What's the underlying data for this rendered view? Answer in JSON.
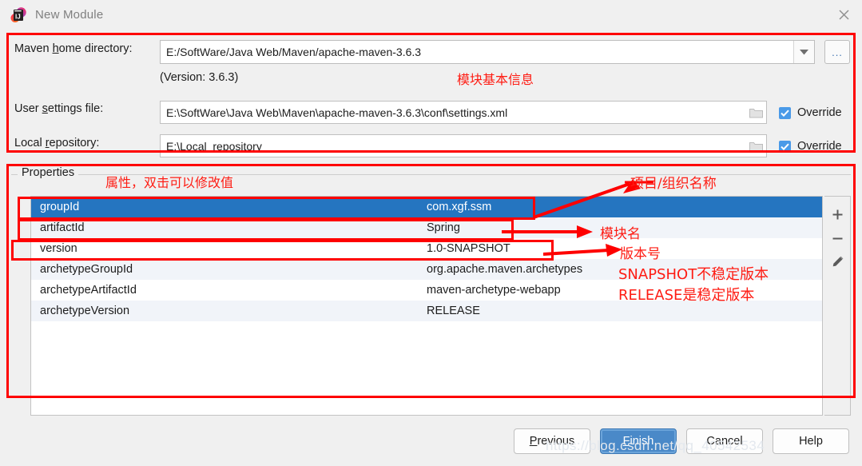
{
  "window": {
    "title": "New Module",
    "app_icon": "intellij-idea-icon",
    "close_icon": "close-icon"
  },
  "settings": {
    "maven_home": {
      "label_pre": "Maven ",
      "label_mnemonic": "h",
      "label_post": "ome directory:",
      "value": "E:/SoftWare/Java Web/Maven/apache-maven-3.6.3",
      "dropdown_icon": "chevron-down-icon",
      "browse_label": "...",
      "browse_icon": "ellipsis-icon"
    },
    "version_note": "(Version: 3.6.3)",
    "user_settings": {
      "label_pre": "User ",
      "label_mnemonic": "s",
      "label_post": "ettings file:",
      "value": "E:\\SoftWare\\Java Web\\Maven\\apache-maven-3.6.3\\conf\\settings.xml",
      "folder_icon": "folder-icon",
      "override_label": "Override",
      "override_checked": true
    },
    "local_repository": {
      "label_pre": "Local ",
      "label_mnemonic": "r",
      "label_post": "epository:",
      "value": "E:\\Local_repository",
      "folder_icon": "folder-icon",
      "override_label": "Override",
      "override_checked": true
    }
  },
  "properties": {
    "legend": "Properties",
    "rows": [
      {
        "key": "groupId",
        "value": "com.xgf.ssm"
      },
      {
        "key": "artifactId",
        "value": "Spring"
      },
      {
        "key": "version",
        "value": "1.0-SNAPSHOT"
      },
      {
        "key": "archetypeGroupId",
        "value": "org.apache.maven.archetypes"
      },
      {
        "key": "archetypeArtifactId",
        "value": "maven-archetype-webapp"
      },
      {
        "key": "archetypeVersion",
        "value": "RELEASE"
      }
    ],
    "selected_row_index": 0,
    "tools": [
      {
        "name": "add-property-button",
        "icon": "plus-icon",
        "label": "+"
      },
      {
        "name": "remove-property-button",
        "icon": "minus-icon",
        "label": "−"
      },
      {
        "name": "edit-property-button",
        "icon": "pencil-icon",
        "label": ""
      }
    ]
  },
  "buttons": {
    "previous": {
      "pre": "",
      "mnemonic": "P",
      "post": "revious"
    },
    "finish": {
      "pre": "",
      "mnemonic": "F",
      "post": "inish"
    },
    "cancel": {
      "pre": "",
      "mnemonic": "",
      "post": "Cancel"
    },
    "help": {
      "pre": "",
      "mnemonic": "",
      "post": "Help"
    }
  },
  "annotations": {
    "color": "#fe1c13",
    "module_basic_info": "模块基本信息",
    "properties_hint": "属性，双击可以修改值",
    "project_org_name": "项目/组织名称",
    "module_name": "模块名",
    "version_number": "版本号",
    "snapshot_note": "SNAPSHOT不稳定版本",
    "release_note": "RELEASE是稳定版本"
  },
  "watermark": "https://blog.csdn.net/qq_40542534"
}
